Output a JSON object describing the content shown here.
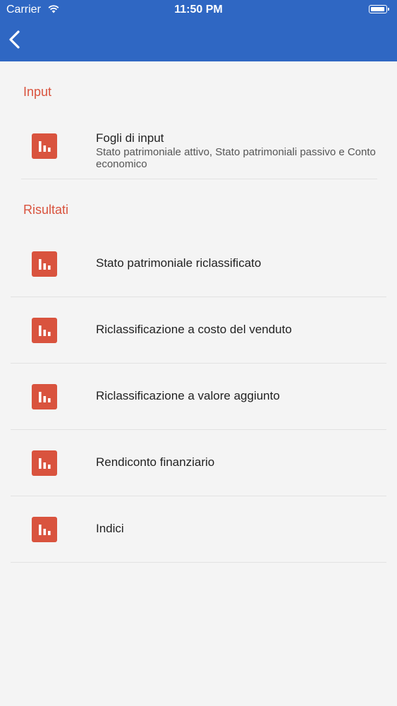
{
  "status_bar": {
    "carrier": "Carrier",
    "time": "11:50 PM",
    "icons": [
      "wifi-icon",
      "battery-icon"
    ]
  },
  "nav": {
    "back_icon": "chevron-left-icon",
    "background": "#2f67c3"
  },
  "accent_color": "#d9533e",
  "sections": [
    {
      "title": "Input",
      "items": [
        {
          "label": "Fogli di input",
          "subtitle": "Stato patrimoniale attivo, Stato patrimoniali passivo e Conto economico",
          "icon": "bar-chart-icon"
        }
      ]
    },
    {
      "title": "Risultati",
      "items": [
        {
          "label": "Stato patrimoniale riclassificato",
          "icon": "bar-chart-icon"
        },
        {
          "label": "Riclassificazione a costo del venduto",
          "icon": "bar-chart-icon"
        },
        {
          "label": "Riclassificazione a valore aggiunto",
          "icon": "bar-chart-icon"
        },
        {
          "label": "Rendiconto finanziario",
          "icon": "bar-chart-icon"
        },
        {
          "label": "Indici",
          "icon": "bar-chart-icon"
        }
      ]
    }
  ]
}
